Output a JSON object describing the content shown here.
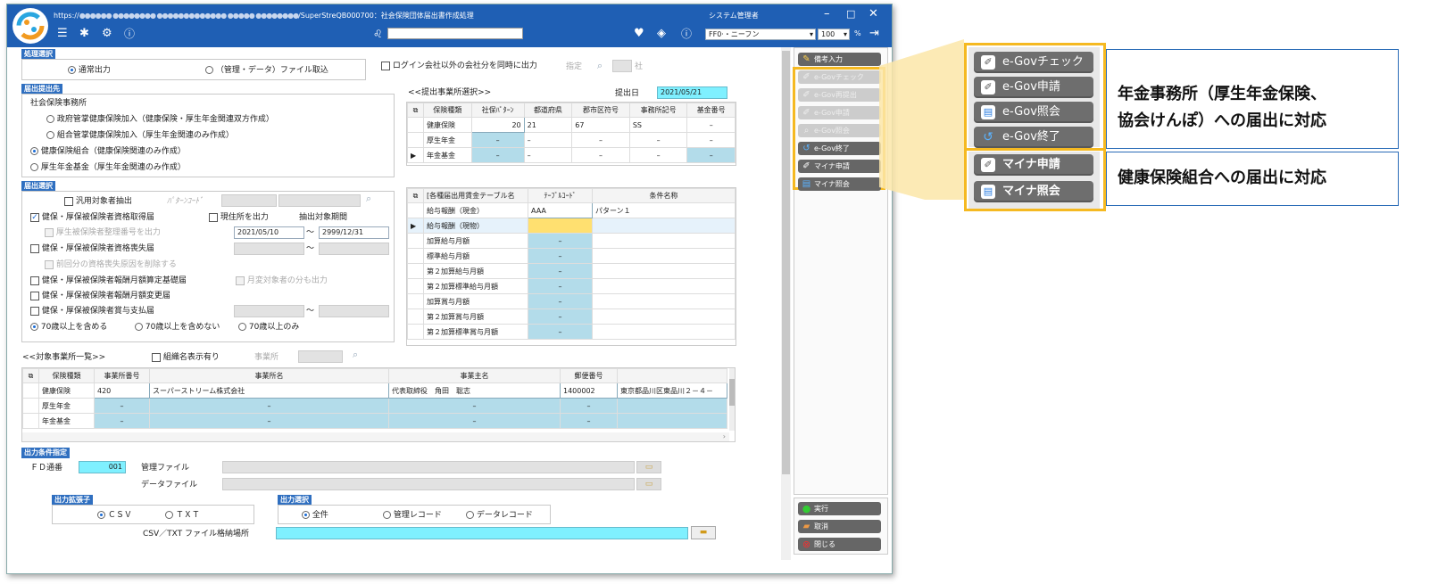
{
  "titlebar": {
    "url_prefix": "https://",
    "url_blurred": "●●●●●● ●●●●●●●● ●●●●●●●●●●●●● ●●●●● ●●●●●●●●",
    "url_tail": "/SuperStreQB000700：社会保険団体届出書作成処理",
    "user": "システム管理者",
    "company_select": "FF0·・ニーフン",
    "zoom": "100",
    "zoom_unit": "%"
  },
  "shori": {
    "section": "処理選択",
    "opt_normal": "通常出力",
    "opt_import": "（管理・データ）ファイル取込",
    "login_other": "ログイン会社以外の会社分を同時に出力",
    "shitei": "指定",
    "sha": "社"
  },
  "todoke_saki": {
    "section": "届出提出先",
    "label": "社会保険事務所",
    "opt1": "政府管掌健康保険加入（健康保険・厚生年金関連双方作成）",
    "opt2": "組合管掌健康保険加入（厚生年金関連のみ作成）",
    "opt3": "健康保険組合（健康保険関連のみ作成）",
    "opt4": "厚生年金基金（厚生年金関連のみ作成）"
  },
  "teishutsu": {
    "title": "<<提出事業所選択>>",
    "date_label": "提出日",
    "date_value": "2021/05/21",
    "headers": [
      "保険種類",
      "社保ﾊﾟﾀｰﾝ",
      "都道府県",
      "郡市区符号",
      "事務所記号",
      "基金番号"
    ],
    "rows": [
      {
        "type": "健康保険",
        "pattern": "20",
        "pref": "21",
        "city": "67",
        "office": "SS",
        "fund": "–"
      },
      {
        "type": "厚生年金",
        "pattern": "–",
        "pref": "–",
        "city": "–",
        "office": "–",
        "fund": "–"
      },
      {
        "type": "年金基金",
        "pattern": "–",
        "pref": "–",
        "city": "–",
        "office": "–",
        "fund": "–"
      }
    ]
  },
  "todoke_sentaku": {
    "section": "届出選択",
    "hanyo": "汎用対象者抽出",
    "pattern_code": "ﾊﾟﾀｰﾝｺｰﾄﾞ",
    "item1": "健保・厚保被保険者資格取得届",
    "item1_sub": "厚生被保険者整理番号を出力",
    "genzai": "現住所を出力",
    "kikan_label": "抽出対象期間",
    "date_from": "2021/05/10",
    "date_to": "2999/12/31",
    "tilde": "～",
    "item2": "健保・厚保被保険者資格喪失届",
    "item2_sub": "前回分の資格喪失原因を削除する",
    "item3": "健保・厚保被保険者報酬月額算定基礎届",
    "getsuhen": "月変対象者の分も出力",
    "item4": "健保・厚保被保険者報酬月額変更届",
    "item5": "健保・厚保被保険者賞与支払届",
    "age1": "70歳以上を含める",
    "age2": "70歳以上を含めない",
    "age3": "70歳以上のみ"
  },
  "kakushu": {
    "headers": [
      "[各種届出用賃金テーブル名",
      "ﾃｰﾌﾞﾙｺｰﾄﾞ",
      "条件名称"
    ],
    "rows": [
      {
        "name": "給与報酬（現金）",
        "code": "AAA",
        "cond": "パターン１"
      },
      {
        "name": "給与報酬（現物）",
        "code": "",
        "cond": ""
      },
      {
        "name": "加算給与月額",
        "code": "–",
        "cond": ""
      },
      {
        "name": "標準給与月額",
        "code": "–",
        "cond": ""
      },
      {
        "name": "第２加算給与月額",
        "code": "–",
        "cond": ""
      },
      {
        "name": "第２加算標準給与月額",
        "code": "–",
        "cond": ""
      },
      {
        "name": "加算賞与月額",
        "code": "–",
        "cond": ""
      },
      {
        "name": "第２加算賞与月額",
        "code": "–",
        "cond": ""
      },
      {
        "name": "第２加算標準賞与月額",
        "code": "–",
        "cond": ""
      }
    ]
  },
  "taisho": {
    "title": "<<対象事業所一覧>>",
    "soshiki": "組織名表示有り",
    "jigyosho": "事業所",
    "headers": [
      "保険種類",
      "事業所番号",
      "事業所名",
      "事業主名",
      "郵便番号",
      ""
    ],
    "rows": [
      {
        "type": "健康保険",
        "no": "420",
        "name": "スーパーストリーム株式会社",
        "owner": "代表取締役　角田　聡志",
        "zip": "1400002",
        "addr": "東京都品川区東品川２－４－"
      },
      {
        "type": "厚生年金",
        "no": "–",
        "name": "–",
        "owner": "–",
        "zip": "–",
        "addr": ""
      },
      {
        "type": "年金基金",
        "no": "–",
        "name": "–",
        "owner": "–",
        "zip": "–",
        "addr": ""
      }
    ]
  },
  "output": {
    "section": "出力条件指定",
    "fd_label": "ＦＤ通番",
    "fd_value": "001",
    "kanri": "管理ファイル",
    "data": "データファイル",
    "ext_section": "出力拡張子",
    "csv": "ＣＳＶ",
    "txt": "ＴＸＴ",
    "sel_section": "出力選択",
    "all": "全件",
    "kanri_rec": "管理レコード",
    "data_rec": "データレコード",
    "path_label": "CSV／TXT ファイル格納場所"
  },
  "right": {
    "biko": "備考入力",
    "egov_check": "e-Govチェック",
    "egov_resubmit": "e-Gov再提出",
    "egov_apply": "e-Gov申請",
    "egov_inquiry": "e-Gov照会",
    "egov_end": "e-Gov終了",
    "myna_apply": "マイナ申請",
    "myna_inquiry": "マイナ照会",
    "exec": "実行",
    "cancel": "取消",
    "close": "閉じる"
  },
  "callout": {
    "b1": "e-Govチェック",
    "b2": "e-Gov申請",
    "b3": "e-Gov照会",
    "b4": "e-Gov終了",
    "b5": "マイナ申請",
    "b6": "マイナ照会",
    "note1a": "年金事務所（厚生年金保険、",
    "note1b": "協会けんぽ）への届出に対応",
    "note2": "健康保険組合への届出に対応"
  }
}
